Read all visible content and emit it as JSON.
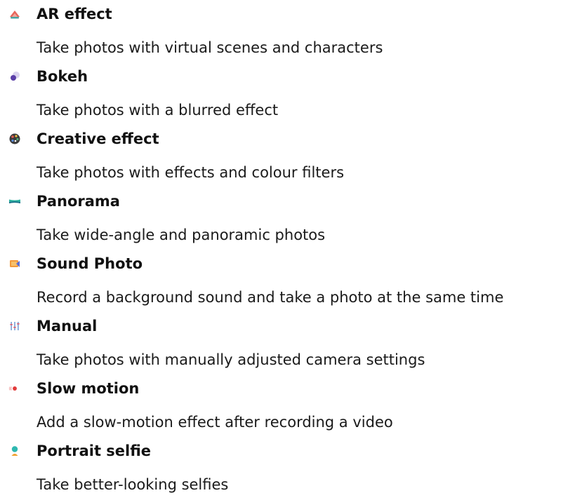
{
  "modes": [
    {
      "title": "AR effect",
      "description": "Take photos with virtual scenes and characters",
      "icon": "ar-effect-icon"
    },
    {
      "title": "Bokeh",
      "description": "Take photos with a blurred effect",
      "icon": "bokeh-icon"
    },
    {
      "title": "Creative effect",
      "description": "Take photos with effects and colour filters",
      "icon": "palette-icon"
    },
    {
      "title": "Panorama",
      "description": "Take wide-angle and panoramic photos",
      "icon": "panorama-icon"
    },
    {
      "title": "Sound Photo",
      "description": "Record a background sound and take a photo at the same time",
      "icon": "sound-photo-icon"
    },
    {
      "title": "Manual",
      "description": "Take photos with manually adjusted camera settings",
      "icon": "sliders-icon"
    },
    {
      "title": "Slow motion",
      "description": "Add a slow-motion effect after recording a video",
      "icon": "slow-motion-icon"
    },
    {
      "title": "Portrait selfie",
      "description": "Take better-looking selfies",
      "icon": "portrait-selfie-icon"
    }
  ]
}
